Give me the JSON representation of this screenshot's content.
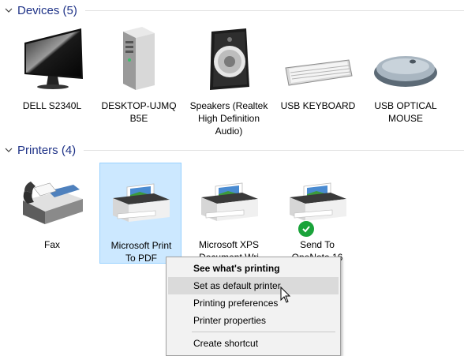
{
  "groups": {
    "devices": {
      "title": "Devices (5)"
    },
    "printers": {
      "title": "Printers (4)"
    }
  },
  "devices": [
    {
      "label": "DELL S2340L",
      "icon": "monitor-icon"
    },
    {
      "label": "DESKTOP-UJMQ\nB5E",
      "icon": "computer-tower-icon"
    },
    {
      "label": "Speakers (Realtek\nHigh Definition\nAudio)",
      "icon": "speaker-icon"
    },
    {
      "label": "USB KEYBOARD",
      "icon": "keyboard-icon"
    },
    {
      "label": "USB OPTICAL\nMOUSE",
      "icon": "mouse-icon"
    }
  ],
  "printers": [
    {
      "label": "Fax",
      "icon": "fax-icon"
    },
    {
      "label": "Microsoft Print\nTo PDF",
      "icon": "printer-icon",
      "selected": true
    },
    {
      "label": "Microsoft XPS\nDocument Wri",
      "icon": "printer-icon"
    },
    {
      "label": "Send To\nOneNote 16",
      "icon": "printer-icon",
      "default": true
    }
  ],
  "context_menu": {
    "items": [
      {
        "label": "See what's printing",
        "bold": true
      },
      {
        "label": "Set as default printer",
        "hover": true
      },
      {
        "label": "Printing preferences"
      },
      {
        "label": "Printer properties"
      },
      {
        "label": "Create shortcut"
      }
    ]
  },
  "colors": {
    "group_title": "#1e3287",
    "selection_bg": "#cce8ff",
    "selection_border": "#99d1ff",
    "default_badge": "#1aa33a",
    "menu_bg": "#f2f2f2"
  }
}
